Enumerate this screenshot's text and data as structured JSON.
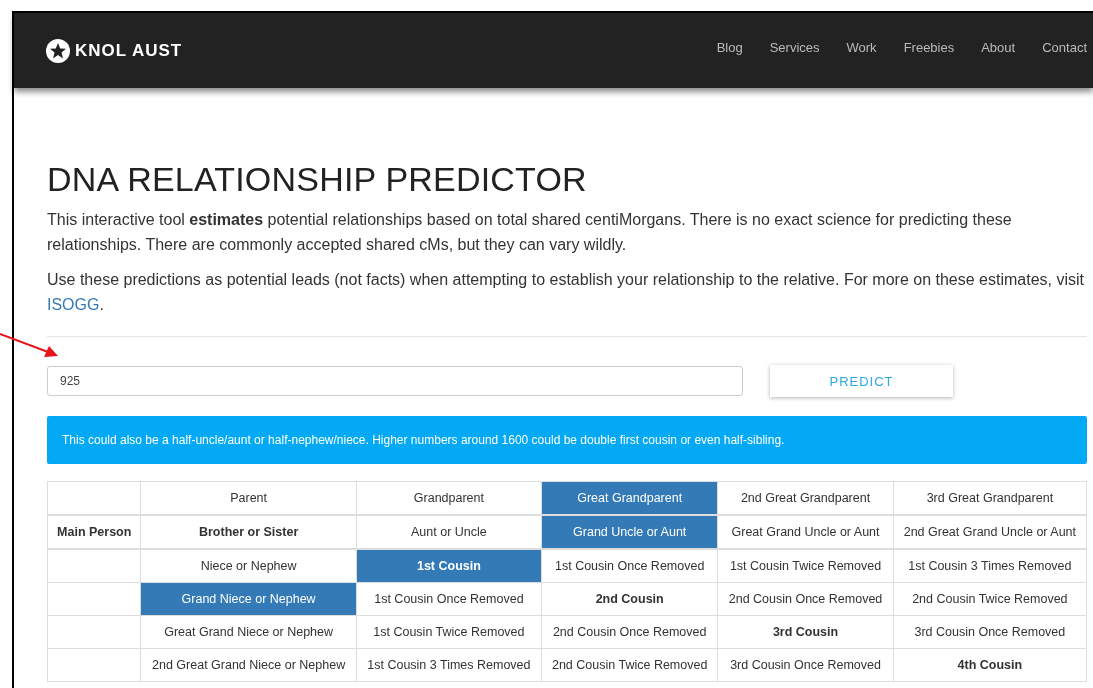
{
  "header": {
    "brand": "KNOL AUST",
    "nav": [
      {
        "label": "Blog"
      },
      {
        "label": "Services"
      },
      {
        "label": "Work"
      },
      {
        "label": "Freebies"
      },
      {
        "label": "About"
      },
      {
        "label": "Contact"
      }
    ]
  },
  "title": "DNA RELATIONSHIP PREDICTOR",
  "intro": "This interactive tool **estimates** potential relationships based on total shared centiMorgans. There is no exact science for predicting these relationships. There are commonly accepted shared cMs, but they can vary wildly.",
  "leads": {
    "text": "Use these predictions as potential leads (not facts) when attempting to establish your relationship to the relative. For more on these estimates, visit ",
    "link": "ISOGG",
    "after": "."
  },
  "input": {
    "value": "925"
  },
  "predict_button": "PREDICT",
  "alert": "This could also be a half-uncle/aunt or half-nephew/niece. Higher numbers around 1600 could be double first cousin or even half-sibling.",
  "table": {
    "rows": [
      [
        {
          "text": "",
          "bold": false,
          "highlighted": false
        },
        {
          "text": "Parent",
          "bold": false,
          "highlighted": false
        },
        {
          "text": "Grandparent",
          "bold": false,
          "highlighted": false
        },
        {
          "text": "Great Grandparent",
          "bold": false,
          "highlighted": true
        },
        {
          "text": "2nd Great Grandparent",
          "bold": false,
          "highlighted": false
        },
        {
          "text": "3rd Great Grandparent",
          "bold": false,
          "highlighted": false
        }
      ],
      [
        {
          "text": "Main Person",
          "bold": true,
          "highlighted": false
        },
        {
          "text": "Brother or Sister",
          "bold": true,
          "highlighted": false
        },
        {
          "text": "Aunt or Uncle",
          "bold": false,
          "highlighted": false
        },
        {
          "text": "Grand Uncle or Aunt",
          "bold": false,
          "highlighted": true
        },
        {
          "text": "Great Grand Uncle or Aunt",
          "bold": false,
          "highlighted": false
        },
        {
          "text": "2nd Great Grand Uncle or Aunt",
          "bold": false,
          "highlighted": false
        }
      ],
      [
        {
          "text": "",
          "bold": false,
          "highlighted": false
        },
        {
          "text": "Niece or Nephew",
          "bold": false,
          "highlighted": false
        },
        {
          "text": "1st Cousin",
          "bold": true,
          "highlighted": true
        },
        {
          "text": "1st Cousin Once Removed",
          "bold": false,
          "highlighted": false
        },
        {
          "text": "1st Cousin Twice Removed",
          "bold": false,
          "highlighted": false
        },
        {
          "text": "1st Cousin 3 Times Removed",
          "bold": false,
          "highlighted": false
        }
      ],
      [
        {
          "text": "",
          "bold": false,
          "highlighted": false
        },
        {
          "text": "Grand Niece or Nephew",
          "bold": false,
          "highlighted": true
        },
        {
          "text": "1st Cousin Once Removed",
          "bold": false,
          "highlighted": false
        },
        {
          "text": "2nd Cousin",
          "bold": true,
          "highlighted": false
        },
        {
          "text": "2nd Cousin Once Removed",
          "bold": false,
          "highlighted": false
        },
        {
          "text": "2nd Cousin Twice Removed",
          "bold": false,
          "highlighted": false
        }
      ],
      [
        {
          "text": "",
          "bold": false,
          "highlighted": false
        },
        {
          "text": "Great Grand Niece or Nephew",
          "bold": false,
          "highlighted": false
        },
        {
          "text": "1st Cousin Twice Removed",
          "bold": false,
          "highlighted": false
        },
        {
          "text": "2nd Cousin Once Removed",
          "bold": false,
          "highlighted": false
        },
        {
          "text": "3rd Cousin",
          "bold": true,
          "highlighted": false
        },
        {
          "text": "3rd Cousin Once Removed",
          "bold": false,
          "highlighted": false
        }
      ],
      [
        {
          "text": "",
          "bold": false,
          "highlighted": false
        },
        {
          "text": "2nd Great Grand Niece or Nephew",
          "bold": false,
          "highlighted": false
        },
        {
          "text": "1st Cousin 3 Times Removed",
          "bold": false,
          "highlighted": false
        },
        {
          "text": "2nd Cousin Twice Removed",
          "bold": false,
          "highlighted": false
        },
        {
          "text": "3rd Cousin Once Removed",
          "bold": false,
          "highlighted": false
        },
        {
          "text": "4th Cousin",
          "bold": true,
          "highlighted": false
        }
      ]
    ]
  }
}
